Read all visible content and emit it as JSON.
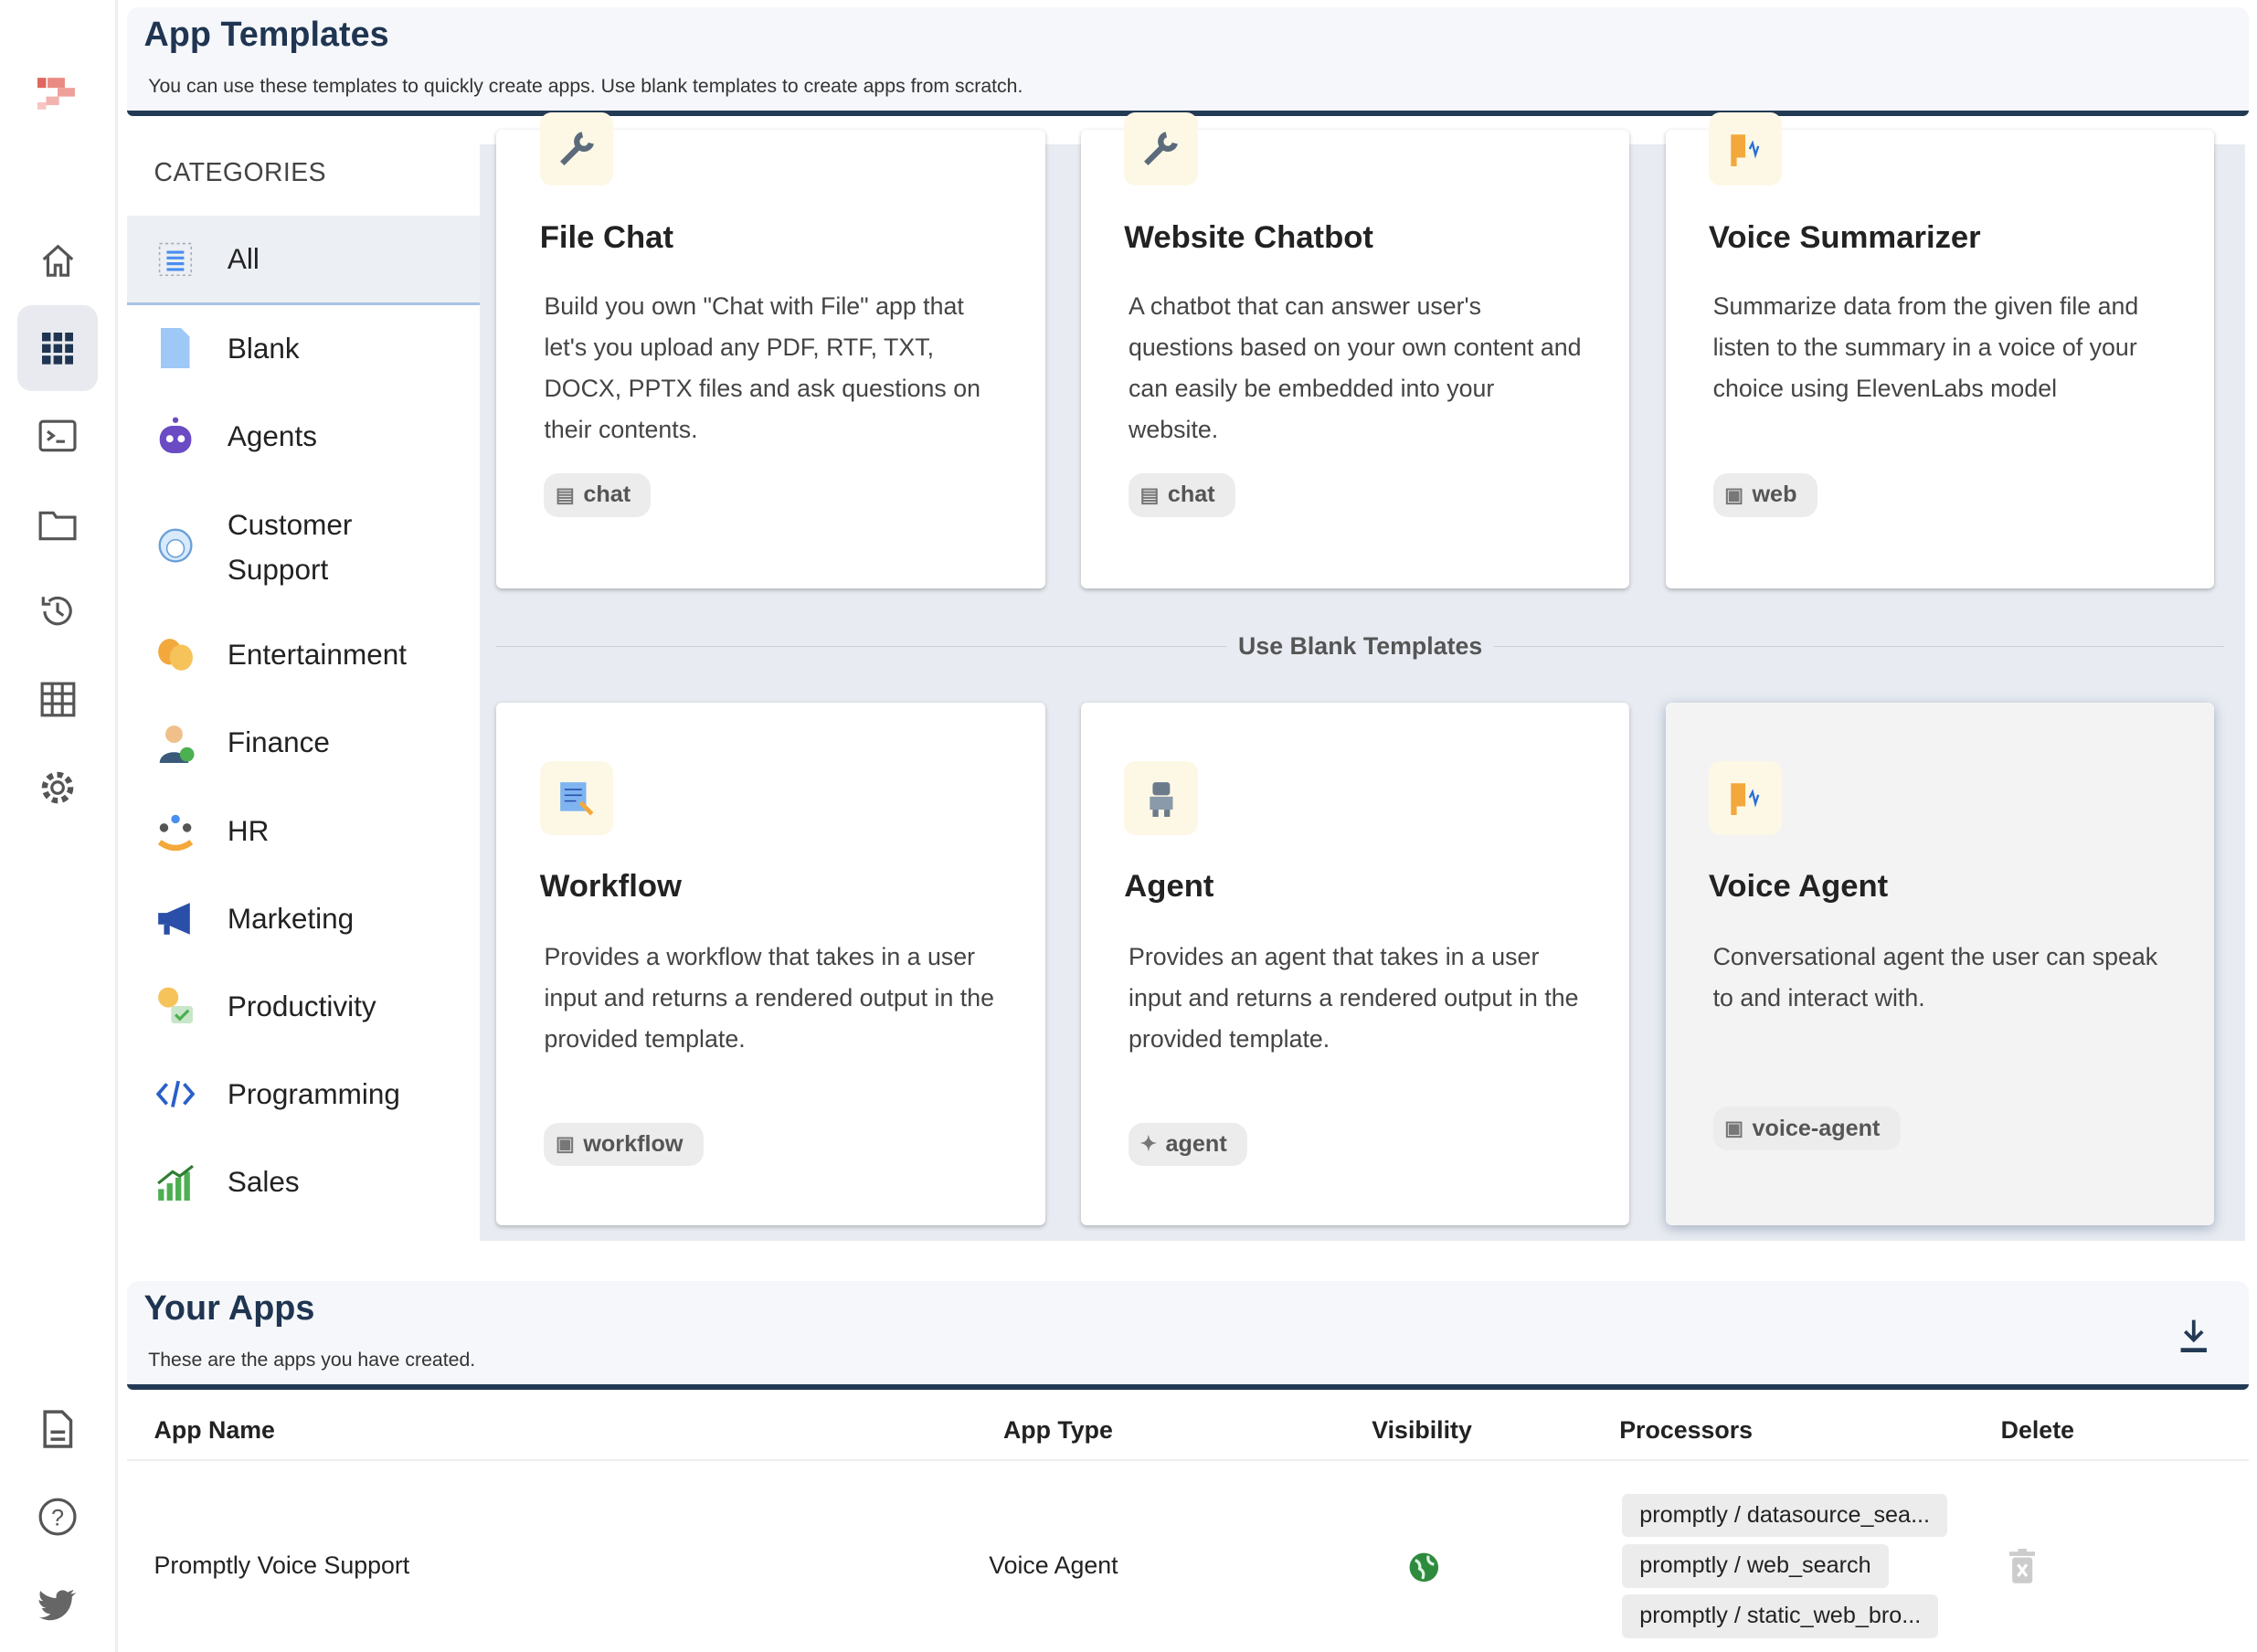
{
  "rail": {
    "items": [
      "logo-icon",
      "home-icon",
      "apps-grid-icon",
      "terminal-icon",
      "folder-icon",
      "history-icon",
      "table-icon",
      "settings-icon"
    ],
    "bottom": [
      "document-icon",
      "help-icon",
      "twitter-icon"
    ],
    "active": "apps-grid-icon"
  },
  "templates_header": {
    "title": "App Templates",
    "subtitle": "You can use these templates to quickly create apps. Use blank templates to create apps from scratch."
  },
  "categories": {
    "title": "CATEGORIES",
    "items": [
      {
        "label": "All",
        "icon": "list-icon",
        "active": true
      },
      {
        "label": "Blank",
        "icon": "blank-page-icon"
      },
      {
        "label": "Agents",
        "icon": "robot-icon"
      },
      {
        "label": "Customer Support",
        "icon": "support-agent-icon"
      },
      {
        "label": "Entertainment",
        "icon": "theater-masks-icon"
      },
      {
        "label": "Finance",
        "icon": "finance-person-icon"
      },
      {
        "label": "HR",
        "icon": "hr-people-icon"
      },
      {
        "label": "Marketing",
        "icon": "megaphone-icon"
      },
      {
        "label": "Productivity",
        "icon": "lightbulb-check-icon"
      },
      {
        "label": "Programming",
        "icon": "code-icon"
      },
      {
        "label": "Sales",
        "icon": "bar-chart-up-icon"
      }
    ]
  },
  "templates": [
    {
      "title": "File Chat",
      "description": "Build you own \"Chat with File\" app that let's you upload any PDF, RTF, TXT, DOCX, PPTX files and ask questions on their contents.",
      "tag": "chat",
      "icon": "wrench-icon"
    },
    {
      "title": "Website Chatbot",
      "description": "A chatbot that can answer user's questions based on your own content and can easily be embedded into your website.",
      "tag": "chat",
      "icon": "wrench-icon"
    },
    {
      "title": "Voice Summarizer",
      "description": "Summarize data from the given file and listen to the summary in a voice of your choice using ElevenLabs model",
      "tag": "web",
      "icon": "speaking-head-icon"
    }
  ],
  "blank_divider": "Use Blank Templates",
  "blank_templates": [
    {
      "title": "Workflow",
      "description": "Provides a workflow that takes in a user input and returns a rendered output in the provided template.",
      "tag": "workflow",
      "icon": "document-edit-icon"
    },
    {
      "title": "Agent",
      "description": "Provides an agent that takes in a user input and returns a rendered output in the provided template.",
      "tag": "agent",
      "icon": "robot-icon"
    },
    {
      "title": "Voice Agent",
      "description": "Conversational agent the user can speak to and interact with.",
      "tag": "voice-agent",
      "icon": "speaking-head-icon"
    }
  ],
  "your_apps": {
    "title": "Your Apps",
    "subtitle": "These are the apps you have created.",
    "columns": [
      "App Name",
      "App Type",
      "Visibility",
      "Processors",
      "Delete"
    ],
    "rows": [
      {
        "name": "Promptly Voice Support",
        "type": "Voice Agent",
        "visibility": "public",
        "processors": [
          "promptly / datasource_sea...",
          "promptly / web_search",
          "promptly / static_web_bro..."
        ]
      }
    ]
  },
  "colors": {
    "header_accent": "#233a55",
    "title": "#1f3552",
    "area_bg": "#e8ecf2"
  }
}
